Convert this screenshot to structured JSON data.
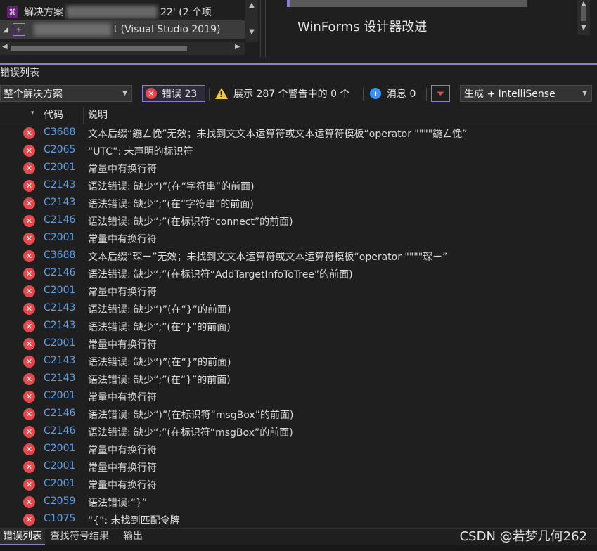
{
  "solution_explorer": {
    "solution_label": "解决方案",
    "solution_suffix": "22' (2 个项",
    "project_suffix": "t (Visual Studio 2019)"
  },
  "news": {
    "item": "WinForms 设计器改进"
  },
  "error_list": {
    "title": "错误列表",
    "scope": "整个解决方案",
    "errors_label": "错误 23",
    "warnings_label": "展示 287 个警告中的 0 个",
    "messages_label": "消息 0",
    "build_filter": "生成 + IntelliSense",
    "columns": {
      "code": "代码",
      "description": "说明"
    },
    "rows": [
      {
        "code": "C3688",
        "desc": "文本后缀“鍦ㄥ悗”无效；未找到文文本运算符或文本运算符模板“operator \"\"\"\"鍦ㄥ悗”"
      },
      {
        "code": "C2065",
        "desc": "“UTC”: 未声明的标识符"
      },
      {
        "code": "C2001",
        "desc": "常量中有换行符"
      },
      {
        "code": "C2143",
        "desc": "语法错误: 缺少“)”(在“字符串”的前面)"
      },
      {
        "code": "C2143",
        "desc": "语法错误: 缺少“;”(在“字符串”的前面)"
      },
      {
        "code": "C2146",
        "desc": "语法错误: 缺少“;”(在标识符“connect”的前面)"
      },
      {
        "code": "C2001",
        "desc": "常量中有换行符"
      },
      {
        "code": "C3688",
        "desc": "文本后缀“琛ㄧ”无效；未找到文文本运算符或文本运算符模板“operator \"\"\"\"琛ㄧ”"
      },
      {
        "code": "C2146",
        "desc": "语法错误: 缺少“;”(在标识符“AddTargetInfoToTree”的前面)"
      },
      {
        "code": "C2001",
        "desc": "常量中有换行符"
      },
      {
        "code": "C2143",
        "desc": "语法错误: 缺少“)”(在“}”的前面)"
      },
      {
        "code": "C2143",
        "desc": "语法错误: 缺少“;”(在“}”的前面)"
      },
      {
        "code": "C2001",
        "desc": "常量中有换行符"
      },
      {
        "code": "C2143",
        "desc": "语法错误: 缺少“)”(在“}”的前面)"
      },
      {
        "code": "C2143",
        "desc": "语法错误: 缺少“;”(在“}”的前面)"
      },
      {
        "code": "C2001",
        "desc": "常量中有换行符"
      },
      {
        "code": "C2146",
        "desc": "语法错误: 缺少“)”(在标识符“msgBox”的前面)"
      },
      {
        "code": "C2146",
        "desc": "语法错误: 缺少“;”(在标识符“msgBox”的前面)"
      },
      {
        "code": "C2001",
        "desc": "常量中有换行符"
      },
      {
        "code": "C2001",
        "desc": "常量中有换行符"
      },
      {
        "code": "C2001",
        "desc": "常量中有换行符"
      },
      {
        "code": "C2059",
        "desc": "语法错误:“}”"
      },
      {
        "code": "C1075",
        "desc": "“{”: 未找到匹配令牌"
      }
    ]
  },
  "bottom_tabs": {
    "error_list": "错误列表",
    "find_symbol_results": "查找符号结果",
    "output": "输出"
  },
  "watermark": "CSDN @若梦几何262",
  "colors": {
    "accent": "#8e7bd6",
    "error": "#e5484d",
    "warning": "#f2c744",
    "info": "#3794ff",
    "link": "#5aa1ee",
    "background": "#1f1f1f"
  }
}
